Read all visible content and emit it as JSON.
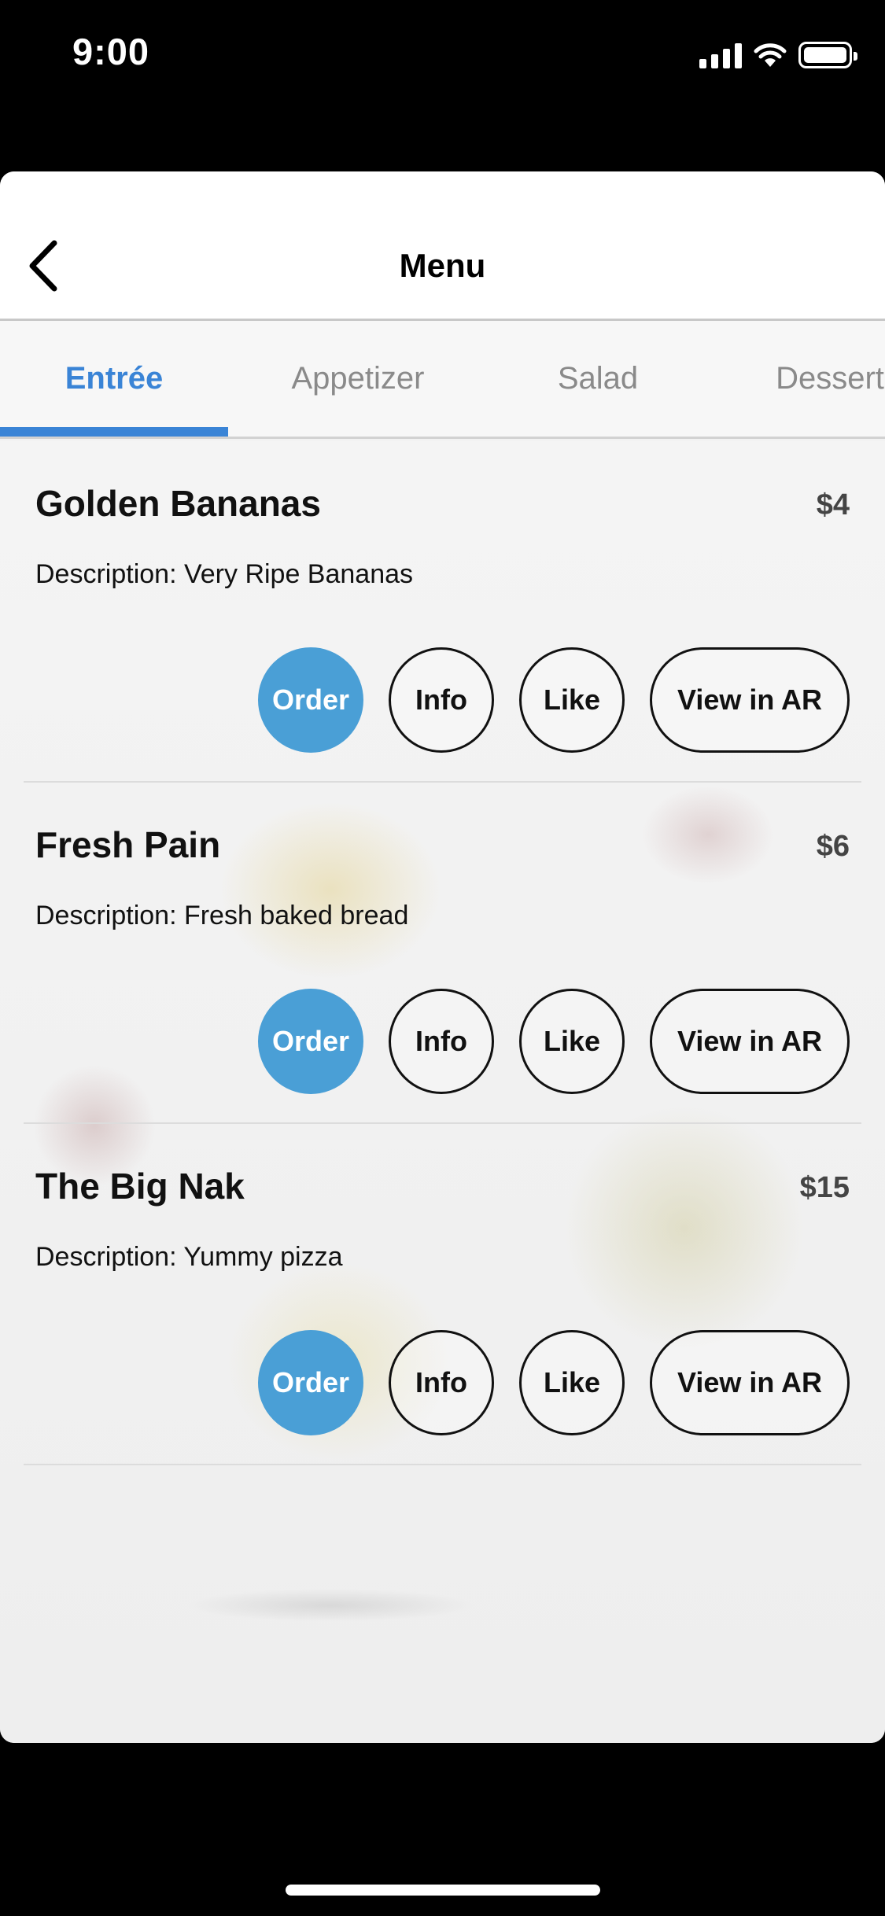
{
  "status_bar": {
    "time": "9:00",
    "icons": [
      "signal-icon",
      "wifi-icon",
      "battery-icon"
    ]
  },
  "nav": {
    "title": "Menu",
    "back_icon": "chevron-left-icon"
  },
  "tabs": [
    {
      "label": "Entrée",
      "active": true
    },
    {
      "label": "Appetizer",
      "active": false
    },
    {
      "label": "Salad",
      "active": false
    },
    {
      "label": "Dessert",
      "active": false
    }
  ],
  "menu_items": [
    {
      "name": "Golden Bananas",
      "price": "$4",
      "description": "Description: Very Ripe Bananas",
      "actions": {
        "order": "Order",
        "info": "Info",
        "like": "Like",
        "ar": "View in AR"
      }
    },
    {
      "name": "Fresh Pain",
      "price": "$6",
      "description": "Description: Fresh baked bread",
      "actions": {
        "order": "Order",
        "info": "Info",
        "like": "Like",
        "ar": "View in AR"
      }
    },
    {
      "name": "The Big Nak",
      "price": "$15",
      "description": "Description: Yummy pizza",
      "actions": {
        "order": "Order",
        "info": "Info",
        "like": "Like",
        "ar": "View in AR"
      }
    }
  ],
  "colors": {
    "accent": "#3a84d6",
    "order_button": "#4a9fd6",
    "background": "#000000"
  }
}
